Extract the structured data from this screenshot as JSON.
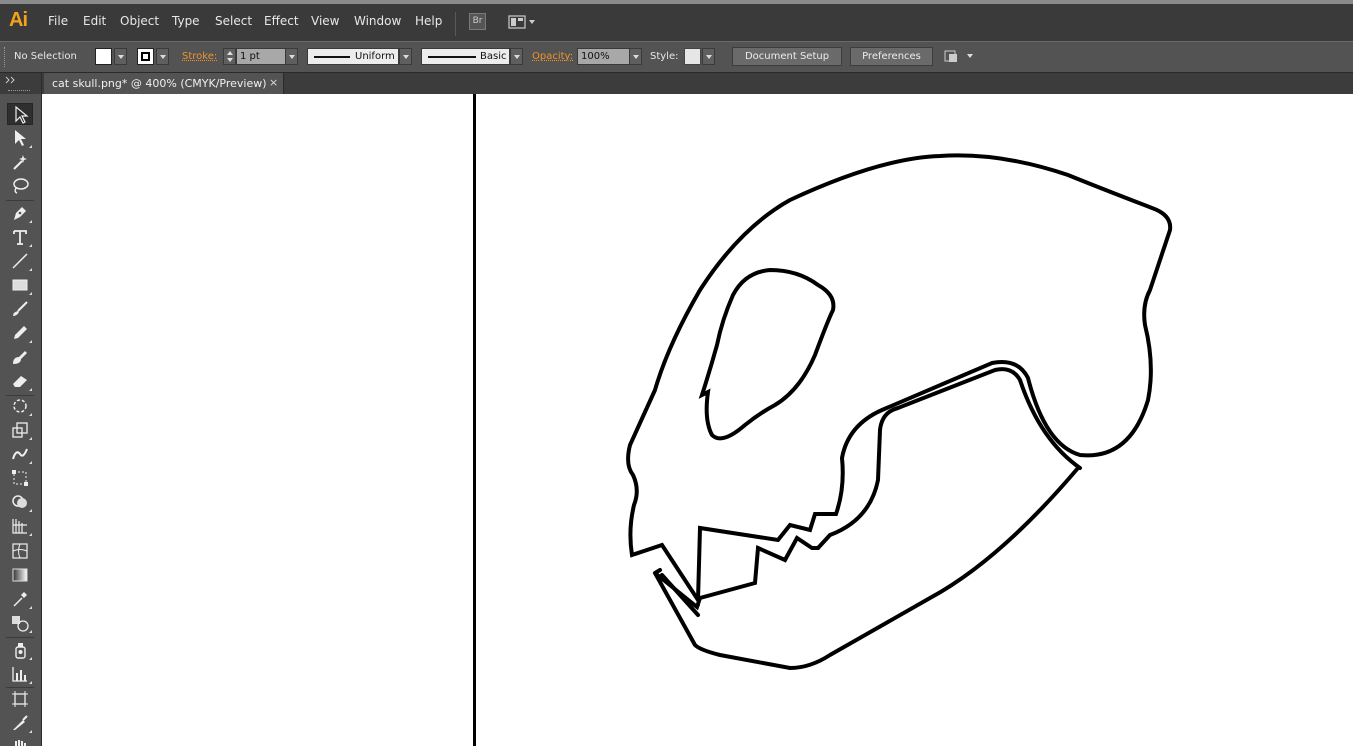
{
  "app": {
    "logo": "Ai"
  },
  "menu": [
    "File",
    "Edit",
    "Object",
    "Type",
    "Select",
    "Effect",
    "View",
    "Window",
    "Help"
  ],
  "bridge_button": "Br",
  "control_bar": {
    "selection_label": "No Selection",
    "stroke_label": "Stroke:",
    "stroke_weight": "1 pt",
    "profile": "Uniform",
    "brush": "Basic",
    "opacity_label": "Opacity:",
    "opacity_value": "100%",
    "style_label": "Style:",
    "document_setup": "Document Setup",
    "preferences": "Preferences"
  },
  "document_tab": {
    "title": "cat skull.png* @ 400% (CMYK/Preview)",
    "close": "×"
  },
  "colors": {
    "accent": "#f3a21b",
    "link": "#f0922a",
    "panel": "#535353",
    "menubar": "#3a3a3a"
  },
  "tools": [
    "selection-tool-icon",
    "direct-selection-tool-icon",
    "magic-wand-tool-icon",
    "lasso-tool-icon",
    "pen-tool-icon",
    "type-tool-icon",
    "line-segment-tool-icon",
    "rectangle-tool-icon",
    "paintbrush-tool-icon",
    "pencil-tool-icon",
    "blob-brush-tool-icon",
    "eraser-tool-icon",
    "rotate-tool-icon",
    "scale-tool-icon",
    "warp-tool-icon",
    "free-transform-tool-icon",
    "shape-builder-tool-icon",
    "perspective-grid-tool-icon",
    "mesh-tool-icon",
    "gradient-tool-icon",
    "eyedropper-tool-icon",
    "blend-tool-icon",
    "symbol-sprayer-tool-icon",
    "column-graph-tool-icon",
    "artboard-tool-icon",
    "slice-tool-icon",
    "hand-tool-icon"
  ]
}
